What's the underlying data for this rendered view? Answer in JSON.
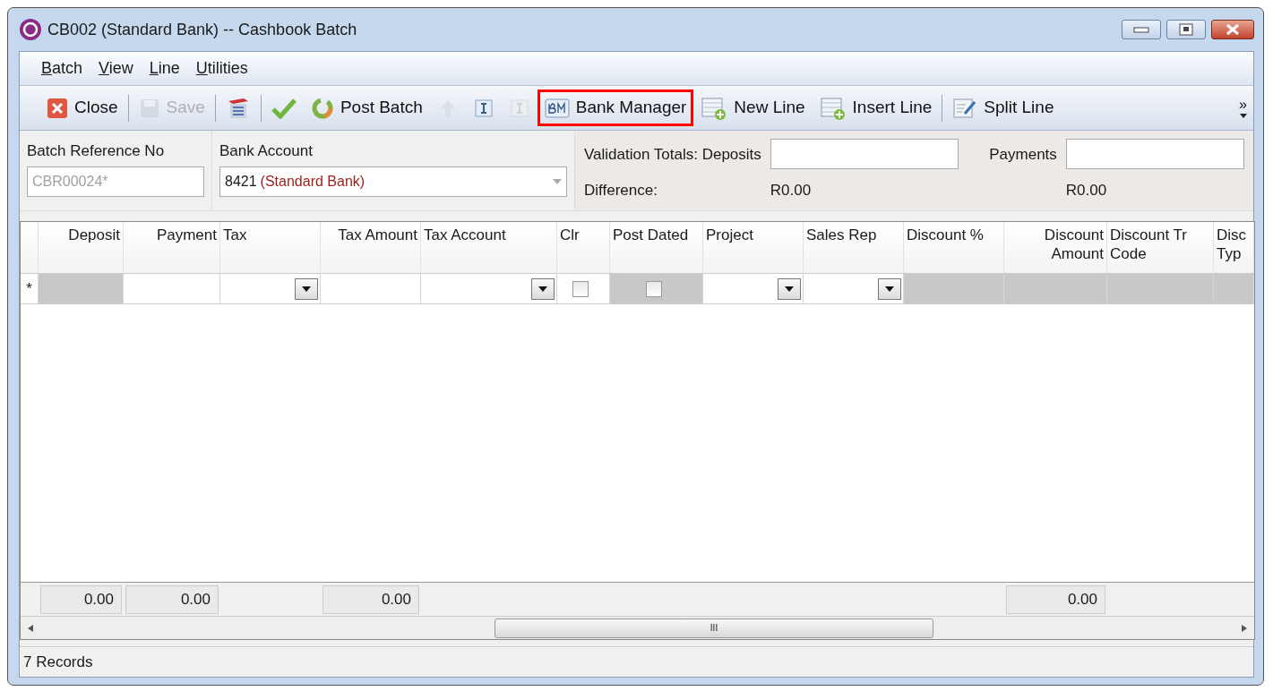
{
  "window": {
    "title": "CB002 (Standard Bank) -- Cashbook Batch"
  },
  "menu": [
    {
      "label": "Batch"
    },
    {
      "label": "View"
    },
    {
      "label": "Line"
    },
    {
      "label": "Utilities"
    }
  ],
  "toolbar": [
    {
      "kind": "button",
      "label": "Close",
      "disabled": false
    },
    {
      "kind": "separator"
    },
    {
      "kind": "button",
      "label": "Save",
      "disabled": true
    },
    {
      "kind": "separator"
    },
    {
      "kind": "button",
      "disabled": false
    },
    {
      "kind": "separator"
    },
    {
      "kind": "button",
      "disabled": false
    },
    {
      "kind": "button",
      "label": "Post Batch",
      "disabled": false
    },
    {
      "kind": "button",
      "disabled": true
    },
    {
      "kind": "button",
      "disabled": false
    },
    {
      "kind": "button",
      "disabled": true
    },
    {
      "kind": "button",
      "label": "Bank Manager",
      "disabled": false,
      "highlighted": true
    },
    {
      "kind": "button",
      "label": "New Line",
      "disabled": false
    },
    {
      "kind": "button",
      "label": "Insert Line",
      "disabled": false
    },
    {
      "kind": "separator"
    },
    {
      "kind": "button",
      "label": "Split Line",
      "disabled": false
    }
  ],
  "overflow": {
    "label": "»"
  },
  "header": {
    "batch_reference_label": "Batch Reference No",
    "batch_reference": "CBR00024*",
    "batch_reference_disabled": true,
    "bank_account_label": "Bank Account",
    "bank_account_code": "8421",
    "bank_account_name": "(Standard Bank)",
    "validation_label": "Validation Totals: Deposits",
    "payments_label": "Payments",
    "difference_label": "Difference:",
    "difference_deposits": "R0.00",
    "difference_payments": "R0.00"
  },
  "grid": {
    "new_row_marker": "*",
    "columns": [
      {
        "label": "Deposit",
        "kind": "text",
        "readonly": true,
        "total": "0.00"
      },
      {
        "label": "Payment",
        "kind": "text",
        "readonly": false,
        "total": "0.00"
      },
      {
        "label": "Tax",
        "kind": "combo",
        "readonly": false
      },
      {
        "label": "Tax Amount",
        "kind": "text",
        "readonly": false,
        "total": "0.00"
      },
      {
        "label": "Tax Account",
        "kind": "combo",
        "readonly": false
      },
      {
        "label": "Clr",
        "kind": "check",
        "readonly": false,
        "checked": false
      },
      {
        "label": "Post Dated",
        "kind": "check",
        "readonly": true,
        "checked": false
      },
      {
        "label": "Project",
        "kind": "combo",
        "readonly": false
      },
      {
        "label": "Sales Rep",
        "kind": "combo",
        "readonly": false
      },
      {
        "label": "Discount %",
        "kind": "text",
        "readonly": true
      },
      {
        "label": "Discount Amount",
        "kind": "text",
        "readonly": true,
        "total": "0.00"
      },
      {
        "label": "Discount Tr Code",
        "kind": "text",
        "readonly": true
      },
      {
        "label": "Disc Typ",
        "kind": "text",
        "readonly": true
      }
    ]
  },
  "scrollbar": {
    "grip": "III"
  },
  "status_bar": {
    "text": "7 Records"
  }
}
